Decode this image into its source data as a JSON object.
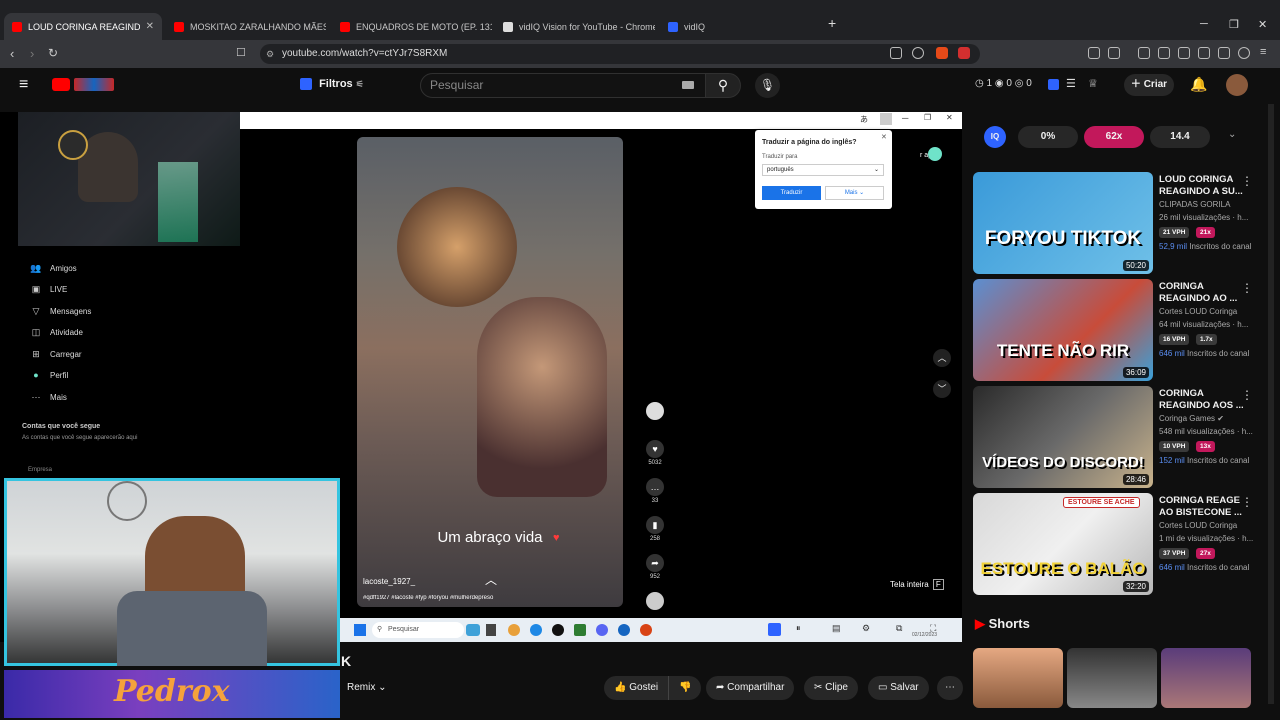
{
  "tabs": [
    {
      "label": "LOUD CORINGA REAGINDO A...",
      "active": true
    },
    {
      "label": "MOSKITAO ZARALHANDO MÃES SO..."
    },
    {
      "label": "ENQUADROS DE MOTO (EP. 131) - Yo..."
    },
    {
      "label": "vidIQ Vision for YouTube - Chrome W..."
    },
    {
      "label": "vidIQ"
    }
  ],
  "browser": {
    "url": "youtube.com/watch?v=ctYJr7S8RXM",
    "new_tab": "+"
  },
  "youtube": {
    "filters": "Filtros",
    "search_placeholder": "Pesquisar",
    "create": "Criar",
    "counters": [
      "1",
      "0",
      "0"
    ]
  },
  "video_screen": {
    "translate": {
      "title": "Traduzir a página do inglês?",
      "label": "Traduzir para",
      "language": "português",
      "translate_btn": "Traduzir",
      "more": "Mais",
      "app": "r app"
    },
    "tiktok": {
      "caption": "Um abraço vida",
      "username": "lacoste_1927_",
      "hashtags": "#qdff1927 #lacoste #fyp #foryou #mulherdepreso",
      "likes": "5032",
      "comments": "33",
      "saves": "258",
      "shares": "952"
    },
    "nav": [
      "Amigos",
      "LIVE",
      "Mensagens",
      "Atividade",
      "Carregar",
      "Perfil",
      "Mais"
    ],
    "following_title": "Contas que você segue",
    "following_text": "As contas que você segue aparecerão aqui",
    "company": "Empresa",
    "fullscreen": "Tela inteira",
    "fullscreen_key": "F",
    "taskbar_search": "Pesquisar",
    "clock_date": "02/12/2023"
  },
  "overlay": {
    "brand": "Pedrox"
  },
  "actions": {
    "remix": "Remix",
    "like": "Gostei",
    "share": "Compartilhar",
    "clip": "Clipe",
    "save": "Salvar",
    "title_fragment": "K"
  },
  "vidiq": {
    "score": "0%",
    "multiplier": "62x",
    "value": "14.4"
  },
  "recommendations": [
    {
      "title": "LOUD CORINGA REAGINDO A SU...",
      "channel": "CLIPADAS GORILA",
      "views": "26 mil visualizações · h...",
      "vph": "21 VPH",
      "mult": "21x",
      "subs_val": "52,9 mil",
      "subs_label": "Inscritos do canal",
      "duration": "50:20",
      "thumb_text": "FORYOU TIKTOK",
      "mult_color": "#c2185b"
    },
    {
      "title": "CORINGA REAGINDO AO ...",
      "channel": "Cortes LOUD Coringa",
      "views": "64 mil visualizações · h...",
      "vph": "16 VPH",
      "mult": "1.7x",
      "subs_val": "646 mil",
      "subs_label": "Inscritos do canal",
      "duration": "36:09",
      "thumb_text": "TENTE NÃO RIR",
      "mult_color": "#3a3a3a"
    },
    {
      "title": "CORINGA REAGINDO AOS ...",
      "channel": "Coringa Games",
      "views": "548 mil visualizações · h...",
      "vph": "10 VPH",
      "mult": "13x",
      "subs_val": "152 mil",
      "subs_label": "Inscritos do canal",
      "duration": "28:46",
      "thumb_text": "VÍDEOS DO DISCORD!",
      "mult_color": "#c2185b"
    },
    {
      "title": "CORINGA REAGE AO BISTECONE ...",
      "channel": "Cortes LOUD Coringa",
      "views": "1 mi de visualizações · h...",
      "vph": "37 VPH",
      "mult": "27x",
      "subs_val": "646 mil",
      "subs_label": "Inscritos do canal",
      "duration": "32:20",
      "thumb_text": "ESTOURE O BALÃO",
      "thumb_tag": "ESTOURE SE ACHE",
      "mult_color": "#c2185b"
    }
  ],
  "shorts": {
    "title": "Shorts"
  }
}
